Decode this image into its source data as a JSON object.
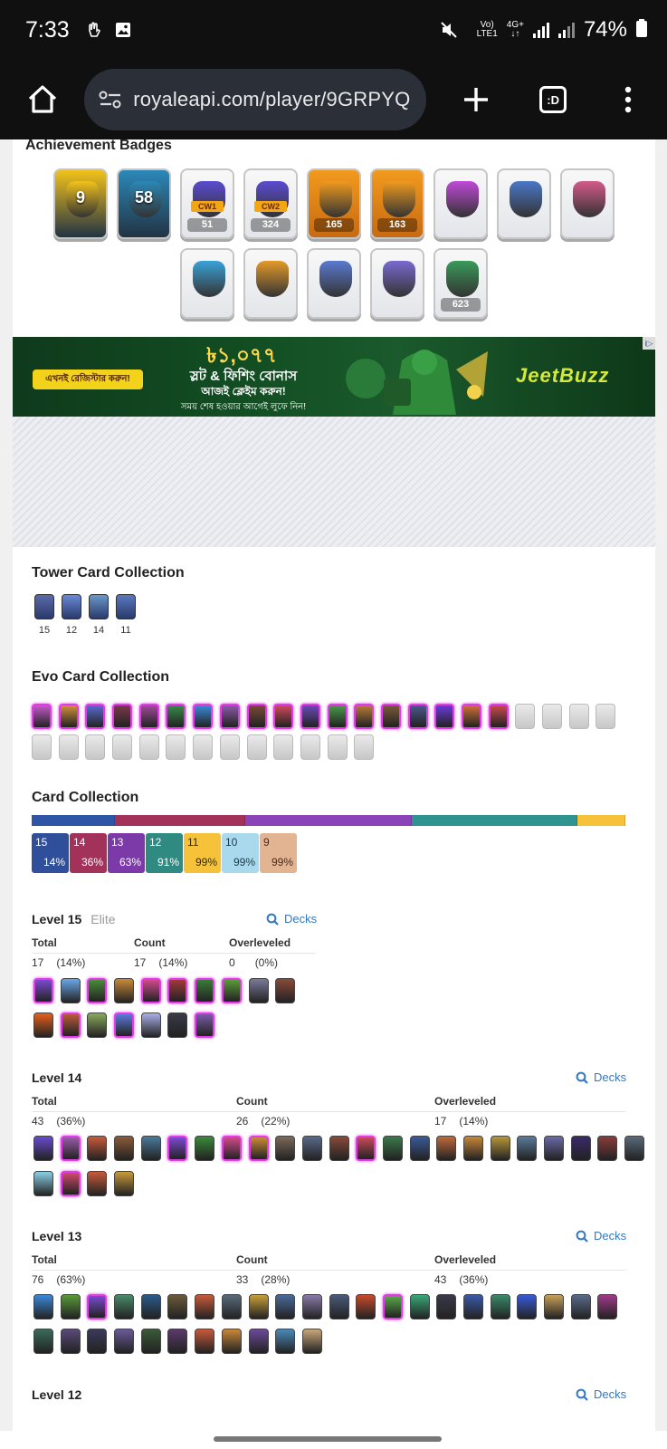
{
  "status_bar": {
    "time": "7:33",
    "net_top": "Vo)",
    "net_bottom": "LTE1",
    "net_gen": "4G+",
    "battery": "74%"
  },
  "browser": {
    "url": "royaleapi.com/player/9GRPYQ",
    "tab_label": ":D"
  },
  "achievement": {
    "title": "Achievement Badges",
    "row1": [
      {
        "icon": "years-played-icon",
        "text": "9",
        "color": "#f2c21a"
      },
      {
        "icon": "level-badge-icon",
        "text": "58",
        "color": "#2b88b8"
      },
      {
        "icon": "cw1-icon",
        "tag": "CW1",
        "caption": "51",
        "color": "#5a4bd1"
      },
      {
        "icon": "cw2-icon",
        "tag": "CW2",
        "caption": "324",
        "color": "#5a4bd1"
      },
      {
        "icon": "crown-chest-icon",
        "caption": "165",
        "color": "#f19a1e"
      },
      {
        "icon": "crown-flag-icon",
        "caption": "163",
        "color": "#f19a1e"
      },
      {
        "icon": "gem-badge-icon",
        "color": "#c04ad8"
      },
      {
        "icon": "shield-badge-icon",
        "color": "#4a78c8"
      },
      {
        "icon": "chest-badge-icon",
        "color": "#d55a8a"
      }
    ],
    "row2": [
      {
        "icon": "card-badge-icon",
        "color": "#3aa2d8"
      },
      {
        "icon": "crown-badge-icon",
        "color": "#e49a2a"
      },
      {
        "icon": "tower-badge-icon",
        "color": "#5a7ad0"
      },
      {
        "icon": "cards-badge-icon",
        "color": "#7a6ad0"
      },
      {
        "icon": "collection-badge-icon",
        "caption": "623",
        "color": "#3a9a5a"
      }
    ]
  },
  "ad": {
    "button": "এখনই রেজিস্টার করুন!",
    "amount": "৳১,০৭৭",
    "line1": "স্লট & ফিশিং বোনাস",
    "line2": "আজই ক্লেইম করুন!",
    "line3": "সময় শেষ হওয়ার আগেই লুফে নিন!",
    "brand": "JeetBuzz",
    "info": "i▷"
  },
  "tower": {
    "title": "Tower Card Collection",
    "items": [
      {
        "level": "15",
        "color": "#5a6aa8"
      },
      {
        "level": "12",
        "color": "#6a8ad8"
      },
      {
        "level": "14",
        "color": "#6a98c8"
      },
      {
        "level": "11",
        "color": "#5a78c0"
      }
    ]
  },
  "evo": {
    "title": "Evo Card Collection",
    "owned": [
      "#c25ac8",
      "#d0903a",
      "#5a6ad0",
      "#7a3a4a",
      "#a04a9a",
      "#3a8a4a",
      "#3a8ad8",
      "#8a5aa8",
      "#7a4a3a",
      "#d04a5a",
      "#6a4ab8",
      "#4a9a4a",
      "#b87a3a",
      "#7a5a3a",
      "#4a5a8a",
      "#6a3ad8",
      "#d0703a",
      "#c84a4a"
    ],
    "unowned_row1": 4,
    "unowned_row2": 13
  },
  "collection": {
    "title": "Card Collection",
    "bar": [
      {
        "color": "#2f56a6",
        "weight": 14
      },
      {
        "color": "#a2325a",
        "weight": 22
      },
      {
        "color": "#8a44b8",
        "weight": 28
      },
      {
        "color": "#2f9490",
        "weight": 28
      },
      {
        "color": "#f5c23a",
        "weight": 8
      }
    ],
    "levels": [
      {
        "level": "15",
        "pct": "14%",
        "color": "#2f4f9a",
        "fg": "#ffffff"
      },
      {
        "level": "14",
        "pct": "36%",
        "color": "#a2325a",
        "fg": "#ffffff"
      },
      {
        "level": "13",
        "pct": "63%",
        "color": "#7c3aa8",
        "fg": "#ffffff"
      },
      {
        "level": "12",
        "pct": "91%",
        "color": "#2f8a82",
        "fg": "#ffffff"
      },
      {
        "level": "11",
        "pct": "99%",
        "color": "#f5c23a",
        "fg": "#3a2a00"
      },
      {
        "level": "10",
        "pct": "99%",
        "color": "#a9d9ec",
        "fg": "#1a3a4a"
      },
      {
        "level": "9",
        "pct": "99%",
        "color": "#e3b492",
        "fg": "#4a2a1a"
      }
    ]
  },
  "level15": {
    "title": "Level 15",
    "sub": "Elite",
    "decks": "Decks",
    "h_total": "Total",
    "h_count": "Count",
    "h_over": "Overleveled",
    "total": "17",
    "total_pct": "(14%)",
    "count": "17",
    "count_pct": "(14%)",
    "over": "0",
    "over_pct": "(0%)",
    "row1": [
      "#7a4ad0",
      "#6aa8e8",
      "#4a8a3a",
      "#c88a3a",
      "#d04a8a",
      "#a03a3a",
      "#3a7a3a",
      "#5a9a3a",
      "#7a7a9a",
      "#8a4a3a"
    ],
    "row2": [
      "#e8601a",
      "#b85a3a",
      "#8aaa5a",
      "#5a7ad8",
      "#aab0e8",
      "#3a3a4a",
      "#7a5aa8"
    ],
    "evo1": [
      0,
      2,
      4,
      5,
      6,
      7
    ],
    "evo2": [
      1,
      3,
      6
    ]
  },
  "level14": {
    "title": "Level 14",
    "decks": "Decks",
    "h_total": "Total",
    "h_count": "Count",
    "h_over": "Overleveled",
    "total": "43",
    "total_pct": "(36%)",
    "count": "26",
    "count_pct": "(22%)",
    "over": "17",
    "over_pct": "(14%)",
    "row1": [
      "#6a4ad0",
      "#9a5aa8",
      "#c85a3a",
      "#8a5a3a",
      "#4a7a9a",
      "#7a4ad0",
      "#3a8a3a",
      "#d04a8a",
      "#c88a3a",
      "#7a6a5a",
      "#5a6a8a",
      "#8a4a3a",
      "#c84a5a",
      "#3a7a4a",
      "#3a5a9a",
      "#c06a3a",
      "#c8883a",
      "#b8983a",
      "#5a7a9a",
      "#6a6aa8",
      "#3a2a6a",
      "#8a3a3a",
      "#5a6a7a"
    ],
    "row2": [
      "#8ad0e8",
      "#d04a6a",
      "#c85a3a",
      "#c89a3a"
    ],
    "evo1": [
      1,
      5,
      7,
      8,
      12
    ],
    "evo2": [
      1
    ]
  },
  "level13": {
    "title": "Level 13",
    "decks": "Decks",
    "h_total": "Total",
    "h_count": "Count",
    "h_over": "Overleveled",
    "total": "76",
    "total_pct": "(63%)",
    "count": "33",
    "count_pct": "(28%)",
    "over": "43",
    "over_pct": "(36%)",
    "row1": [
      "#3a8ad8",
      "#5a9a3a",
      "#7a4ad0",
      "#4a8a6a",
      "#2a5a8a",
      "#6a5a3a",
      "#c85a3a",
      "#5a6a7a",
      "#c8a03a",
      "#4a6a9a",
      "#8a7aa8",
      "#4a5a7a",
      "#c84a2a",
      "#5aa84a",
      "#3aa87a",
      "#3a3a4a",
      "#3a5aa8",
      "#3a8a6a",
      "#3a5ad8",
      "#c8a05a",
      "#5a6a8a",
      "#a03a8a"
    ],
    "row2": [
      "#3a6a5a",
      "#5a4a7a",
      "#3a3a5a",
      "#6a5a9a",
      "#3a5a3a",
      "#5a3a6a",
      "#c85a3a",
      "#c8883a",
      "#6a4a9a",
      "#4a8ab8",
      "#c8a87a"
    ],
    "evo1": [
      2,
      13
    ],
    "evo2": []
  },
  "level12": {
    "title": "Level 12",
    "decks": "Decks"
  }
}
